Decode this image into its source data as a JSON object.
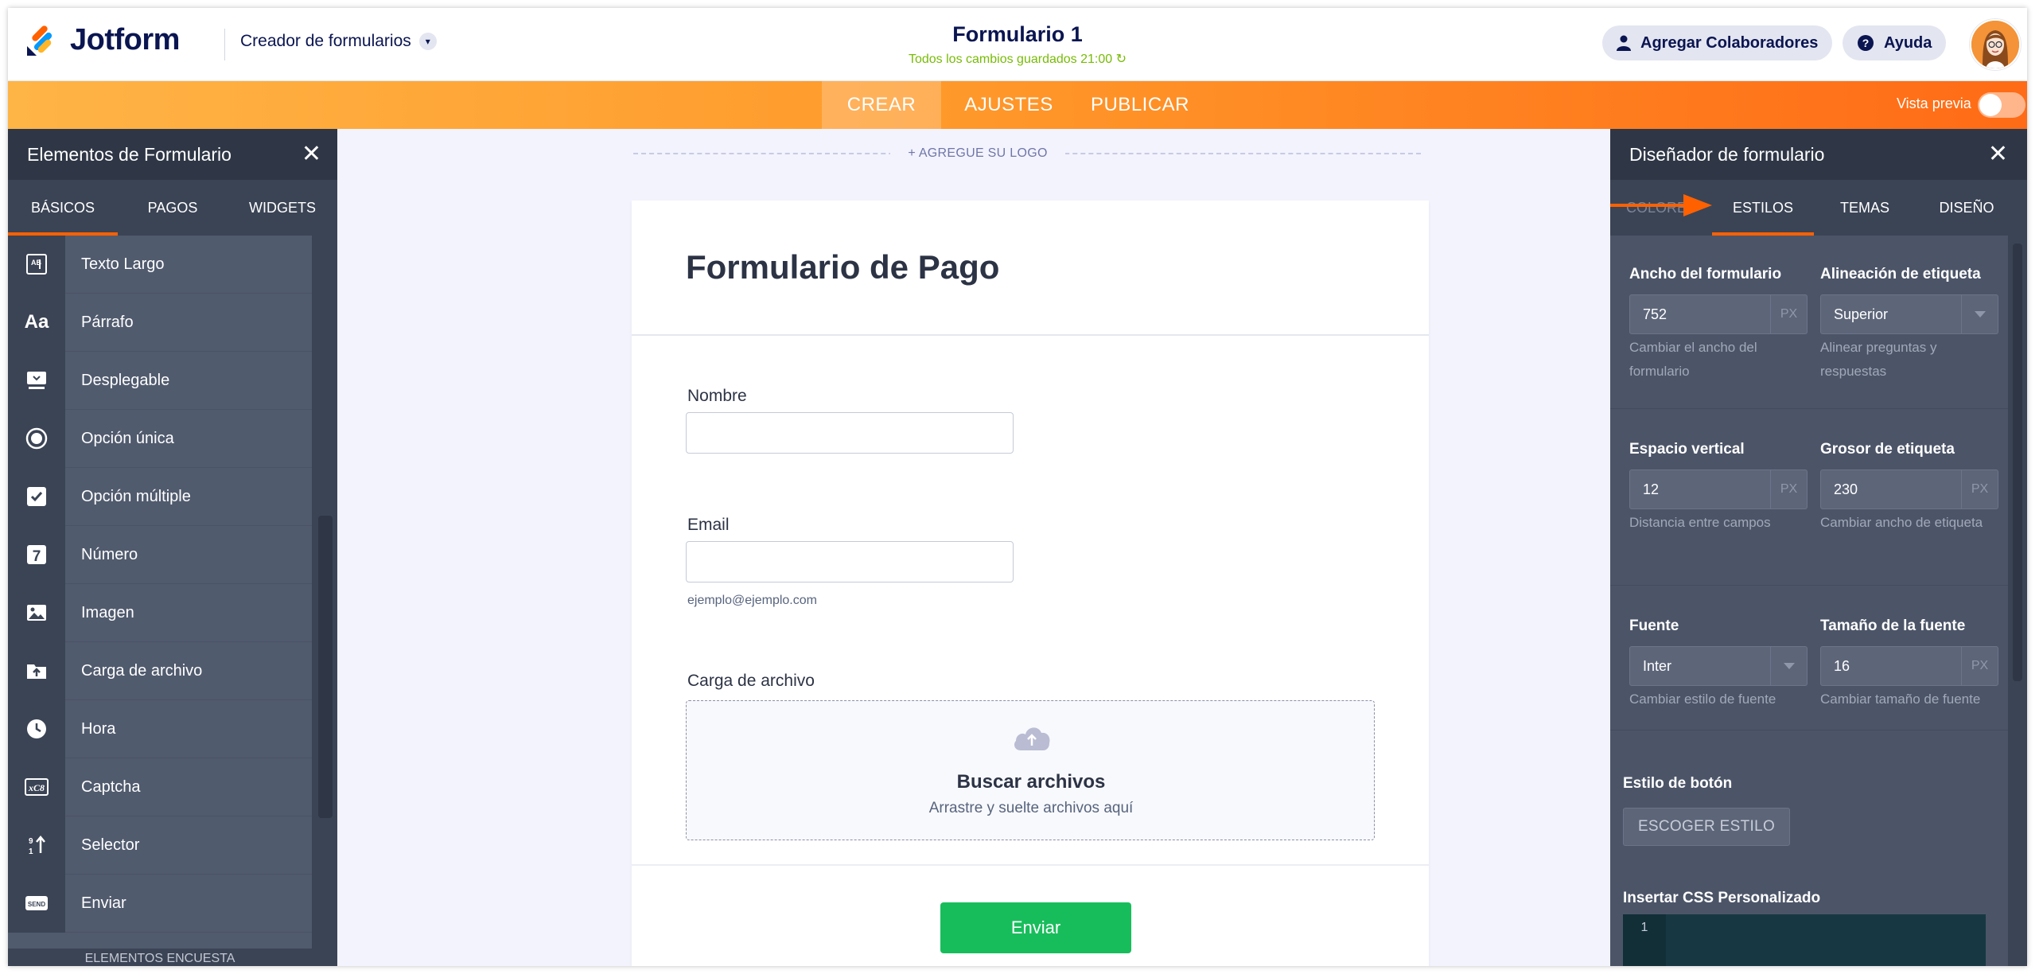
{
  "header": {
    "logo_text": "Jotform",
    "builder_menu": "Creador de formularios",
    "form_title": "Formulario 1",
    "save_status": "Todos los cambios guardados 21:00",
    "collaborators_label": "Agregar Colaboradores",
    "help_label": "Ayuda"
  },
  "navbar": {
    "tabs": [
      "CREAR",
      "AJUSTES",
      "PUBLICAR"
    ],
    "active_tab": "CREAR",
    "preview_label": "Vista previa",
    "preview_on": false
  },
  "left_panel": {
    "title": "Elementos de Formulario",
    "tabs": [
      "BÁSICOS",
      "PAGOS",
      "WIDGETS"
    ],
    "active_tab": "BÁSICOS",
    "items": [
      {
        "label": "Texto Largo",
        "icon": "long-text-icon"
      },
      {
        "label": "Párrafo",
        "icon": "paragraph-icon"
      },
      {
        "label": "Desplegable",
        "icon": "dropdown-icon"
      },
      {
        "label": "Opción única",
        "icon": "radio-icon"
      },
      {
        "label": "Opción múltiple",
        "icon": "checkbox-icon"
      },
      {
        "label": "Número",
        "icon": "number-icon"
      },
      {
        "label": "Imagen",
        "icon": "image-icon"
      },
      {
        "label": "Carga de archivo",
        "icon": "file-upload-icon"
      },
      {
        "label": "Hora",
        "icon": "clock-icon"
      },
      {
        "label": "Captcha",
        "icon": "captcha-icon"
      },
      {
        "label": "Selector",
        "icon": "spinner-icon"
      },
      {
        "label": "Enviar",
        "icon": "send-icon"
      }
    ],
    "footer_label": "ELEMENTOS ENCUESTA"
  },
  "canvas": {
    "logo_prompt": "+ AGREGUE SU LOGO",
    "form_heading": "Formulario de Pago",
    "fields": {
      "name_label": "Nombre",
      "email_label": "Email",
      "email_sublabel": "ejemplo@ejemplo.com",
      "upload_label": "Carga de archivo",
      "upload_title": "Buscar archivos",
      "upload_sub": "Arrastre y suelte archivos aquí"
    },
    "submit_label": "Enviar"
  },
  "right_panel": {
    "title": "Diseñador de formulario",
    "tabs": [
      "COLORES",
      "ESTILOS",
      "TEMAS",
      "DISEÑO"
    ],
    "active_tab": "ESTILOS",
    "form_width": {
      "label": "Ancho del formulario",
      "value": "752",
      "unit": "PX",
      "help": "Cambiar el ancho del formulario"
    },
    "label_alignment": {
      "label": "Alineación de etiqueta",
      "value": "Superior",
      "help": "Alinear preguntas y respuestas"
    },
    "vertical_spacing": {
      "label": "Espacio vertical",
      "value": "12",
      "unit": "PX",
      "help": "Distancia entre campos"
    },
    "label_width": {
      "label": "Grosor de etiqueta",
      "value": "230",
      "unit": "PX",
      "help": "Cambiar ancho de etiqueta"
    },
    "font": {
      "label": "Fuente",
      "value": "Inter",
      "help": "Cambiar estilo de fuente"
    },
    "font_size": {
      "label": "Tamaño de la fuente",
      "value": "16",
      "unit": "PX",
      "help": "Cambiar tamaño de fuente"
    },
    "button_style": {
      "label": "Estilo de botón",
      "button": "ESCOGER ESTILO"
    },
    "custom_css": {
      "label": "Insertar CSS Personalizado",
      "line_number": "1"
    }
  },
  "colors": {
    "brand_orange": "#ff6100",
    "dark_navy": "#0a1551",
    "submit_green": "#18bd5b",
    "save_green": "#78bb07"
  }
}
